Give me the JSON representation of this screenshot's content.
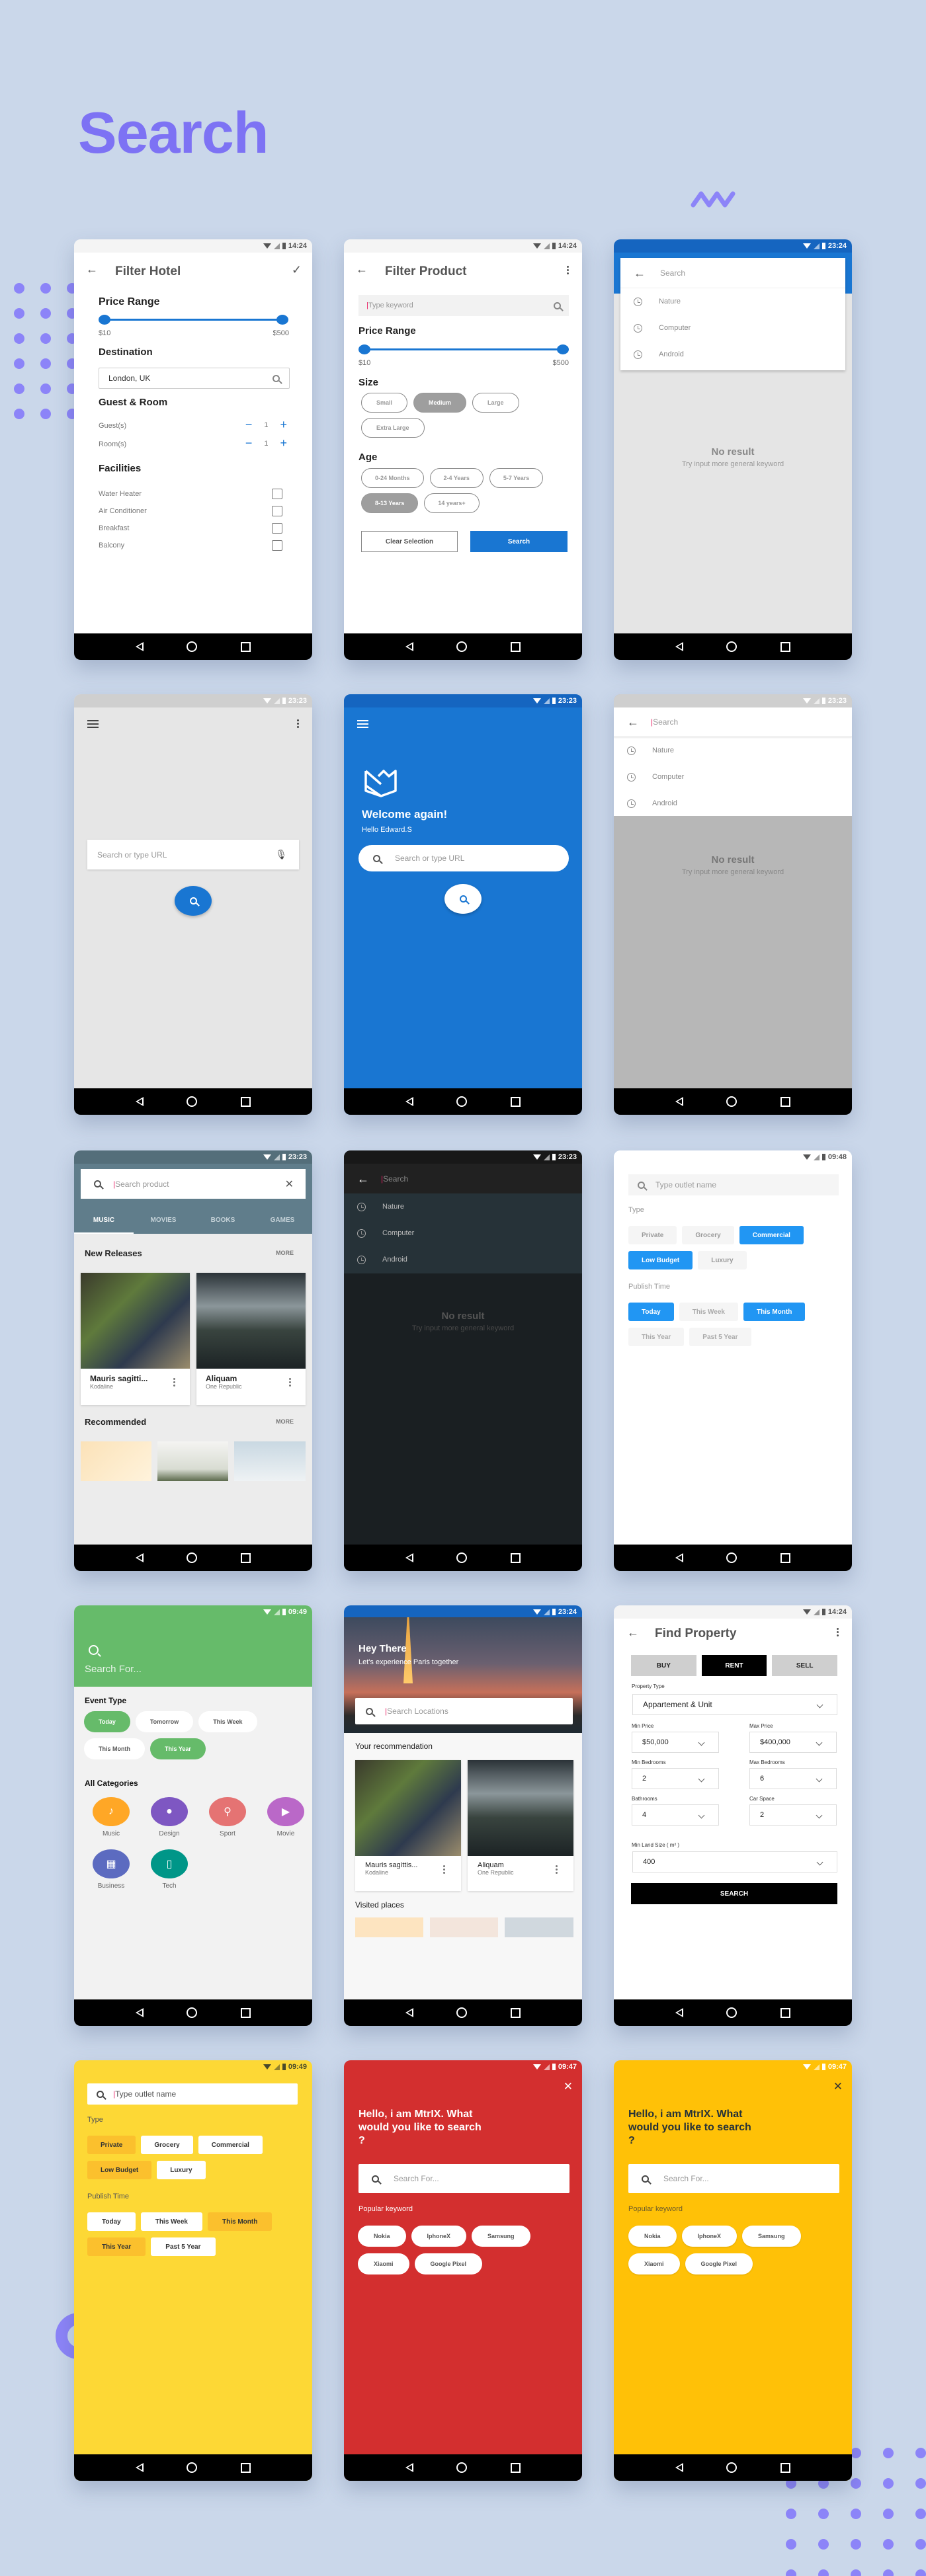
{
  "page": {
    "title": "Search",
    "accent_color": "#7d72f4",
    "background_color": "#cad7ea"
  },
  "screens": {
    "filter_hotel": {
      "time": "14:24",
      "title": "Filter Hotel",
      "price_range_label": "Price Range",
      "price_min": "$10",
      "price_max": "$500",
      "price_range_selected_fraction": [
        0,
        1
      ],
      "destination_label": "Destination",
      "destination_value": "London, UK",
      "guest_room_label": "Guest & Room",
      "guests_label": "Guest(s)",
      "guests_value": "1",
      "rooms_label": "Room(s)",
      "rooms_value": "1",
      "facilities_label": "Facilities",
      "facilities": [
        {
          "label": "Water Heater",
          "checked": false
        },
        {
          "label": "Air Conditioner",
          "checked": false
        },
        {
          "label": "Breakfast",
          "checked": false
        },
        {
          "label": "Balcony",
          "checked": false
        }
      ],
      "accent": "#1976d2"
    },
    "filter_product": {
      "time": "14:24",
      "title": "Filter Product",
      "keyword_placeholder": "Type keyword",
      "price_range_label": "Price Range",
      "price_min": "$10",
      "price_max": "$500",
      "size_label": "Size",
      "sizes": [
        {
          "label": "Small",
          "selected": false
        },
        {
          "label": "Medium",
          "selected": true
        },
        {
          "label": "Large",
          "selected": false
        },
        {
          "label": "Extra Large",
          "selected": false
        }
      ],
      "age_label": "Age",
      "ages": [
        {
          "label": "0-24 Months",
          "selected": false
        },
        {
          "label": "2-4 Years",
          "selected": false
        },
        {
          "label": "5-7 Years",
          "selected": false
        },
        {
          "label": "8-13 Years",
          "selected": true
        },
        {
          "label": "14 years+",
          "selected": false
        }
      ],
      "clear_label": "Clear Selection",
      "search_label": "Search"
    },
    "search_blue_history": {
      "time": "23:24",
      "placeholder": "Search",
      "history": [
        "Nature",
        "Computer",
        "Android"
      ],
      "empty_title": "No result",
      "empty_sub": "Try input more general keyword"
    },
    "browser_grey": {
      "time": "23:23",
      "placeholder": "Search or type URL"
    },
    "browser_blue": {
      "time": "23:23",
      "welcome": "Welcome again!",
      "greeting": "Hello Edward.S",
      "placeholder": "Search or type URL"
    },
    "search_overlay": {
      "time": "23:23",
      "placeholder": "Search",
      "history": [
        "Nature",
        "Computer",
        "Android"
      ],
      "empty_title": "No result",
      "empty_sub": "Try input more general keyword"
    },
    "media_store": {
      "time": "23:23",
      "placeholder": "Search product",
      "tabs": [
        {
          "label": "MUSIC",
          "active": true
        },
        {
          "label": "MOVIES",
          "active": false
        },
        {
          "label": "BOOKS",
          "active": false
        },
        {
          "label": "GAMES",
          "active": false
        }
      ],
      "new_releases_label": "New Releases",
      "more_label": "MORE",
      "cards": [
        {
          "title": "Mauris sagitti...",
          "subtitle": "Kodaline"
        },
        {
          "title": "Aliquam",
          "subtitle": "One Republic"
        }
      ],
      "recommended_label": "Recommended"
    },
    "search_dark": {
      "time": "23:23",
      "placeholder": "Search",
      "history": [
        "Nature",
        "Computer",
        "Android"
      ],
      "empty_title": "No result",
      "empty_sub": "Try input more general keyword"
    },
    "outlet_blue": {
      "time": "09:48",
      "placeholder": "Type outlet name",
      "type_label": "Type",
      "types": [
        {
          "label": "Private",
          "selected": false
        },
        {
          "label": "Grocery",
          "selected": false
        },
        {
          "label": "Commercial",
          "selected": true
        },
        {
          "label": "Low Budget",
          "selected": true
        },
        {
          "label": "Luxury",
          "selected": false
        }
      ],
      "publish_label": "Publish Time",
      "times": [
        {
          "label": "Today",
          "selected": true
        },
        {
          "label": "This Week",
          "selected": false
        },
        {
          "label": "This Month",
          "selected": true
        },
        {
          "label": "This Year",
          "selected": false
        },
        {
          "label": "Past 5 Year",
          "selected": false
        }
      ]
    },
    "event_green": {
      "time": "09:49",
      "placeholder": "Search For...",
      "event_type_label": "Event Type",
      "events": [
        {
          "label": "Today",
          "selected": true
        },
        {
          "label": "Tomorrow",
          "selected": false
        },
        {
          "label": "This Week",
          "selected": false
        },
        {
          "label": "This Month",
          "selected": false
        },
        {
          "label": "This Year",
          "selected": true
        }
      ],
      "categories_label": "All Categories",
      "categories": [
        {
          "label": "Music",
          "icon": "music-note-icon",
          "color": "#ffa726"
        },
        {
          "label": "Design",
          "icon": "palette-icon",
          "color": "#7e57c2"
        },
        {
          "label": "Sport",
          "icon": "bike-icon",
          "color": "#e57373"
        },
        {
          "label": "Movie",
          "icon": "movie-icon",
          "color": "#ba68c8"
        },
        {
          "label": "Business",
          "icon": "building-icon",
          "color": "#5c6bc0"
        },
        {
          "label": "Tech",
          "icon": "tablet-icon",
          "color": "#009688"
        }
      ]
    },
    "travel_paris": {
      "time": "23:24",
      "hero_title": "Hey There",
      "hero_sub": "Let's experience Paris together",
      "placeholder": "Search Locations",
      "recommendation_label": "Your recommendation",
      "cards": [
        {
          "title": "Mauris sagittis...",
          "subtitle": "Kodaline"
        },
        {
          "title": "Aliquam",
          "subtitle": "One Republic"
        }
      ],
      "visited_label": "Visited places"
    },
    "find_property": {
      "time": "14:24",
      "title": "Find Property",
      "modes": [
        {
          "label": "BUY",
          "active": false
        },
        {
          "label": "RENT",
          "active": true
        },
        {
          "label": "SELL",
          "active": false
        }
      ],
      "property_type_label": "Property Type",
      "property_type_value": "Appartement & Unit",
      "min_price_label": "Min Price",
      "min_price_value": "$50,000",
      "max_price_label": "Max Price",
      "max_price_value": "$400,000",
      "min_bed_label": "Min Bedrooms",
      "min_bed_value": "2",
      "max_bed_label": "Max Bedrooms",
      "max_bed_value": "6",
      "bath_label": "Bathrooms",
      "bath_value": "4",
      "car_label": "Car Space",
      "car_value": "2",
      "land_label": "Min Land Size ( m² )",
      "land_value": "400",
      "search_label": "SEARCH"
    },
    "outlet_yellow": {
      "time": "09:49",
      "placeholder": "Type outlet name",
      "type_label": "Type",
      "types": [
        {
          "label": "Private",
          "selected": true
        },
        {
          "label": "Grocery",
          "selected": false
        },
        {
          "label": "Commercial",
          "selected": false
        },
        {
          "label": "Low Budget",
          "selected": true
        },
        {
          "label": "Luxury",
          "selected": false
        }
      ],
      "publish_label": "Publish Time",
      "times": [
        {
          "label": "Today",
          "selected": false
        },
        {
          "label": "This Week",
          "selected": false
        },
        {
          "label": "This Month",
          "selected": true
        },
        {
          "label": "This Year",
          "selected": true
        },
        {
          "label": "Past 5 Year",
          "selected": false
        }
      ]
    },
    "assistant_red": {
      "time": "09:47",
      "headline": "Hello, i am MtrIX. What would you like to search ?",
      "placeholder": "Search For...",
      "popular_label": "Popular keyword",
      "keywords": [
        "Nokia",
        "IphoneX",
        "Samsung",
        "Xiaomi",
        "Google Pixel"
      ],
      "bg": "#d32f2f"
    },
    "assistant_yellow": {
      "time": "09:47",
      "headline": "Hello, i am MtrIX. What would you like to search ?",
      "placeholder": "Search For...",
      "popular_label": "Popular keyword",
      "keywords": [
        "Nokia",
        "IphoneX",
        "Samsung",
        "Xiaomi",
        "Google Pixel"
      ],
      "bg": "#ffc107"
    }
  }
}
